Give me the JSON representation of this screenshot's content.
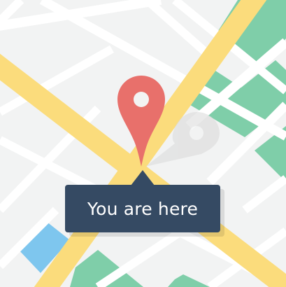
{
  "map": {
    "background_color": "#f2f3f3",
    "road_colors": {
      "major": "#fbdc7c",
      "minor": "#ffffff"
    },
    "block_colors": {
      "park": "#7fcea9",
      "water": "#7ec6ee"
    }
  },
  "marker": {
    "icon": "location-pin-icon",
    "color": "#e8706b",
    "center_color": "#f3f3f3"
  },
  "callout": {
    "text": "You are here",
    "background_color": "#354a63",
    "text_color": "#ffffff"
  }
}
